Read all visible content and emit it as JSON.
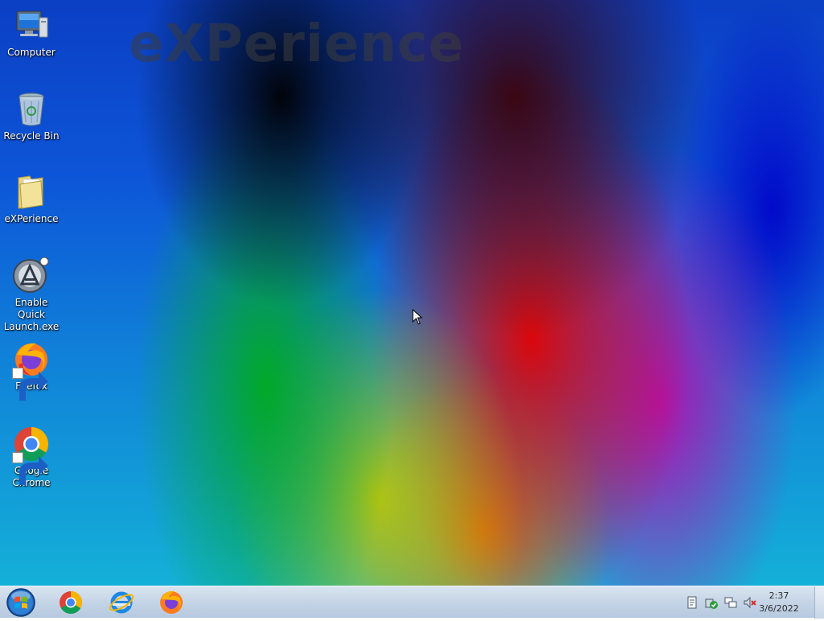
{
  "desktop": {
    "watermark": "eXPerience",
    "icons": [
      {
        "label": "Computer",
        "icon": "computer-icon"
      },
      {
        "label": "Recycle Bin",
        "icon": "recycle-bin-icon"
      },
      {
        "label": "eXPerience",
        "icon": "folder-icon"
      },
      {
        "label": "Enable Quick Launch.exe",
        "icon": "app-icon"
      },
      {
        "label": "Firefox",
        "icon": "firefox-icon"
      },
      {
        "label": "Google Chrome",
        "icon": "chrome-icon"
      }
    ]
  },
  "taskbar": {
    "start": "start-orb-icon",
    "pinned": [
      "chrome-icon",
      "internet-explorer-icon",
      "firefox-icon"
    ],
    "tray": [
      "action-center-icon",
      "security-icon",
      "network-icon",
      "volume-muted-icon"
    ],
    "clock": {
      "time": "2:37",
      "date": "3/6/2022"
    }
  }
}
